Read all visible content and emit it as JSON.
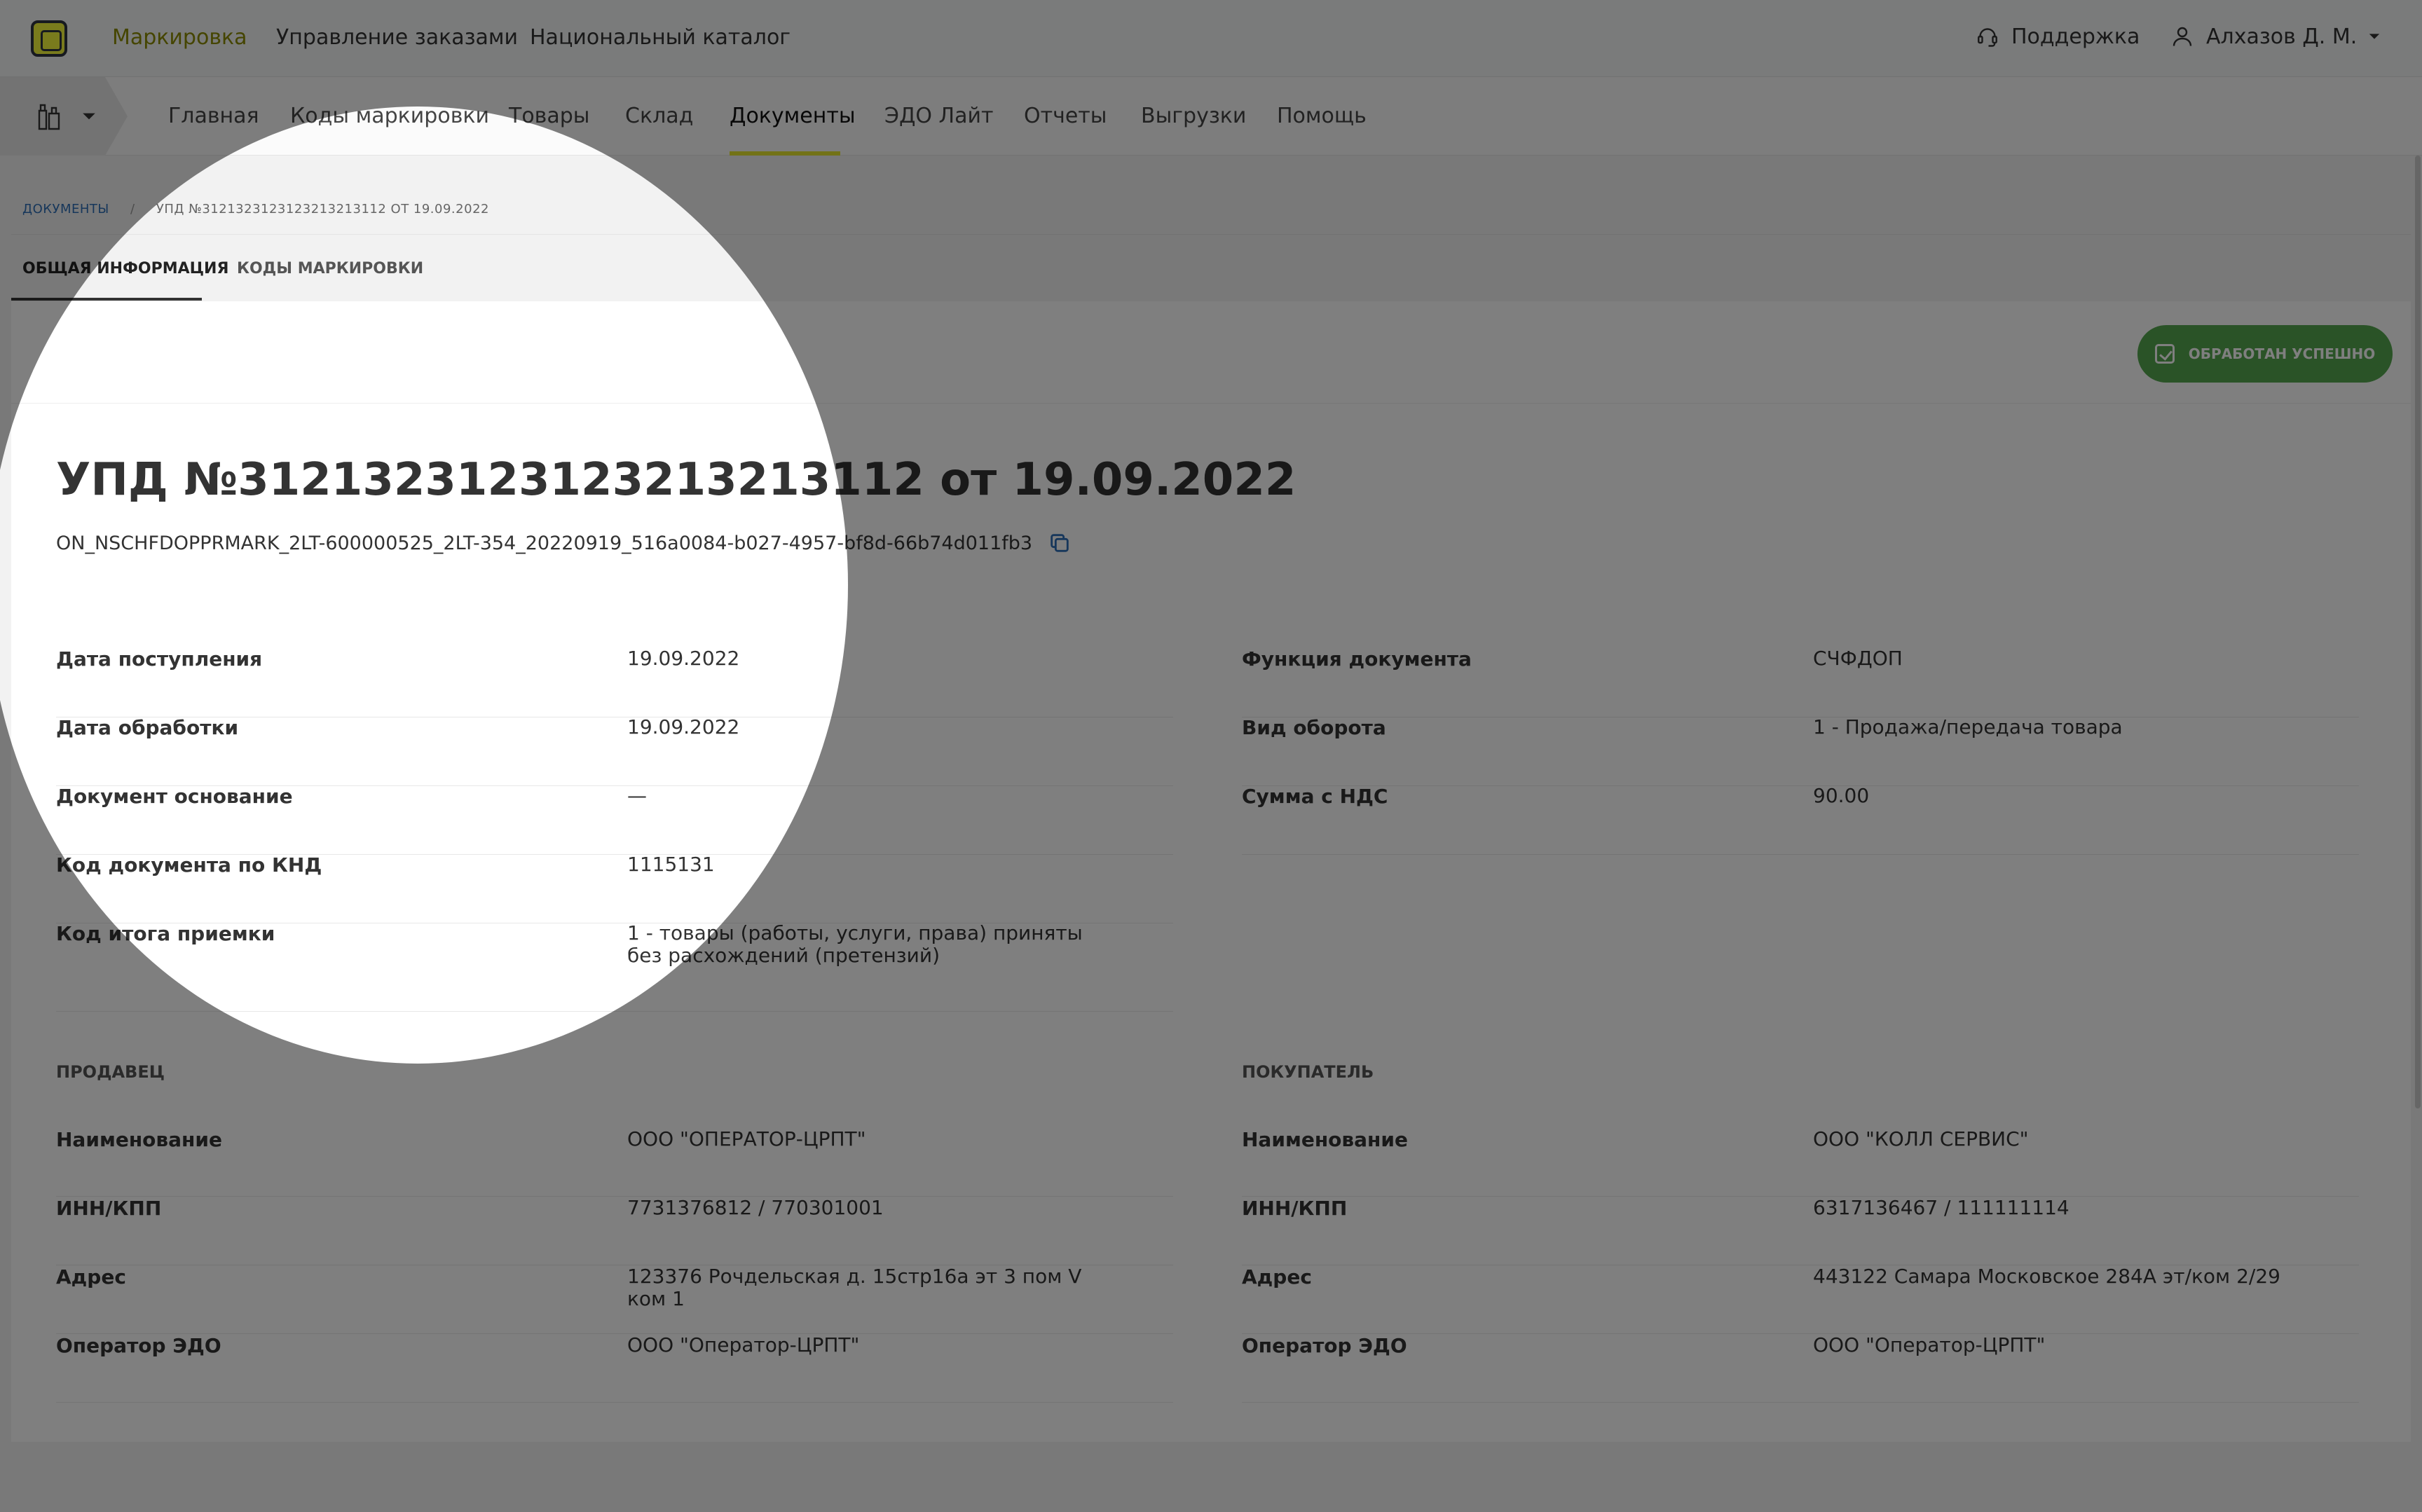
{
  "header": {
    "nav": [
      {
        "label": "Маркировка",
        "active": true
      },
      {
        "label": "Управление заказами",
        "active": false
      },
      {
        "label": "Национальный каталог",
        "active": false
      }
    ],
    "support_label": "Поддержка",
    "user_label": "Алхазов Д. М."
  },
  "subnav": {
    "items": [
      {
        "label": "Главная"
      },
      {
        "label": "Коды маркировки"
      },
      {
        "label": "Товары"
      },
      {
        "label": "Склад"
      },
      {
        "label": "Документы"
      },
      {
        "label": "ЭДО Лайт"
      },
      {
        "label": "Отчеты"
      },
      {
        "label": "Выгрузки"
      },
      {
        "label": "Помощь"
      }
    ],
    "active_label": "Документы"
  },
  "breadcrumb": {
    "root": "Документы",
    "separator": "/",
    "current": "УПД №3121323123123213213112 от 19.09.2022"
  },
  "tabs": [
    {
      "label": "Общая информация"
    },
    {
      "label": "Коды маркировки"
    }
  ],
  "status": {
    "label": "Обработан успешно",
    "color": "#54a64e"
  },
  "document": {
    "title": "УПД №3121323123123213213112 от 19.09.2022",
    "file_id": "ON_NSCHFDOPPRMARK_2LT-600000525_2LT-354_20220919_516a0084-b027-4957-bf8d-66b74d011fb3"
  },
  "details_left": [
    {
      "label": "Дата поступления",
      "value": "19.09.2022"
    },
    {
      "label": "Дата обработки",
      "value": "19.09.2022"
    },
    {
      "label": "Документ основание",
      "value": "—"
    },
    {
      "label": "Код документа по КНД",
      "value": "1115131"
    },
    {
      "label": "Код итога приемки",
      "value": "1 - товары (работы, услуги, права) приняты без расхождений (претензий)"
    }
  ],
  "details_right": [
    {
      "label": "Функция документа",
      "value": "СЧФДОП"
    },
    {
      "label": "Вид оборота",
      "value": "1 - Продажа/передача товара"
    },
    {
      "label": "Сумма с НДС",
      "value": "90.00"
    }
  ],
  "seller": {
    "title": "Продавец",
    "rows": [
      {
        "label": "Наименование",
        "value": "ООО \"ОПЕРАТОР-ЦРПТ\""
      },
      {
        "label": "ИНН/КПП",
        "value": "7731376812 / 770301001"
      },
      {
        "label": "Адрес",
        "value": "123376 Рочдельская д. 15стр16а эт 3 пом V ком 1"
      },
      {
        "label": "Оператор ЭДО",
        "value": "ООО \"Оператор-ЦРПТ\""
      }
    ]
  },
  "buyer": {
    "title": "Покупатель",
    "rows": [
      {
        "label": "Наименование",
        "value": "ООО \"КОЛЛ СЕРВИС\""
      },
      {
        "label": "ИНН/КПП",
        "value": "6317136467 / 111111114"
      },
      {
        "label": "Адрес",
        "value": "443122 Самара Московское 284А эт/ком 2/29"
      },
      {
        "label": "Оператор ЭДО",
        "value": "ООО \"Оператор-ЦРПТ\""
      }
    ]
  }
}
